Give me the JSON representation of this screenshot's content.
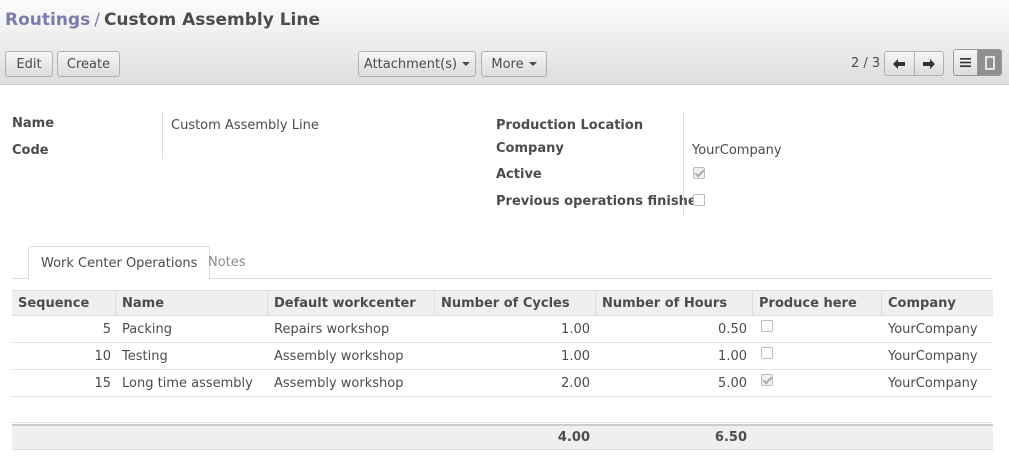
{
  "breadcrumb": {
    "parent": "Routings",
    "separator": "/",
    "current": "Custom Assembly Line"
  },
  "buttons": {
    "edit": "Edit",
    "create": "Create",
    "attachments": "Attachment(s)",
    "more": "More"
  },
  "pager": {
    "text": "2 / 3"
  },
  "form": {
    "name_label": "Name",
    "name_value": "Custom Assembly Line",
    "code_label": "Code",
    "production_location_label": "Production Location",
    "company_label": "Company",
    "company_value": "YourCompany",
    "active_label": "Active",
    "active": true,
    "prev_ops_label": "Previous operations finished",
    "prev_ops": false
  },
  "tabs": [
    {
      "label": "Work Center Operations",
      "active": true
    },
    {
      "label": "Notes",
      "active": false
    }
  ],
  "table": {
    "headers": [
      "Sequence",
      "Name",
      "Default workcenter",
      "Number of Cycles",
      "Number of Hours",
      "Produce here",
      "Company"
    ],
    "rows": [
      {
        "sequence": "5",
        "name": "Packing",
        "workcenter": "Repairs workshop",
        "cycles": "1.00",
        "hours": "0.50",
        "produce_here": false,
        "company": "YourCompany"
      },
      {
        "sequence": "10",
        "name": "Testing",
        "workcenter": "Assembly workshop",
        "cycles": "1.00",
        "hours": "1.00",
        "produce_here": false,
        "company": "YourCompany"
      },
      {
        "sequence": "15",
        "name": "Long time assembly",
        "workcenter": "Assembly workshop",
        "cycles": "2.00",
        "hours": "5.00",
        "produce_here": true,
        "company": "YourCompany"
      }
    ],
    "totals": {
      "cycles": "4.00",
      "hours": "6.50"
    }
  },
  "icons": {
    "prev": "arrow-left-icon",
    "next": "arrow-right-icon",
    "list_view": "list-view-icon",
    "form_view": "form-view-icon"
  },
  "colors": {
    "breadcrumb_link": "#7c7bad"
  }
}
